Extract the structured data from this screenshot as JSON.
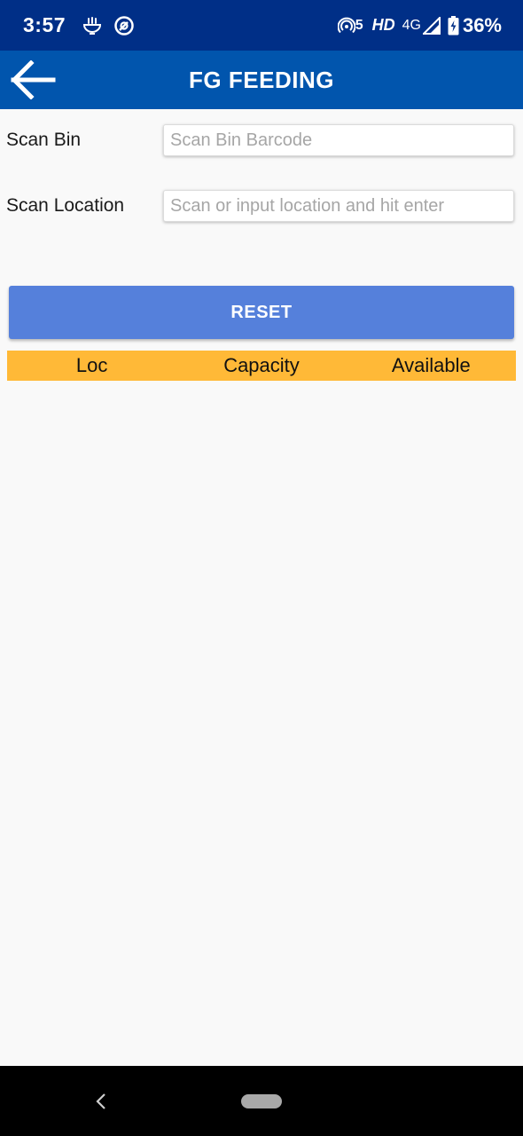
{
  "status_bar": {
    "time": "3:57",
    "hotspot_label": "5",
    "hd": "HD",
    "network": "4G",
    "battery": "36%",
    "icons": [
      "noodle-bowl-icon",
      "app-circle-icon",
      "hotspot-icon",
      "signal-icon",
      "battery-charging-icon"
    ]
  },
  "app_bar": {
    "title": "FG FEEDING",
    "back_icon": "arrow-left-icon"
  },
  "form": {
    "scan_bin": {
      "label": "Scan Bin",
      "placeholder": "Scan Bin Barcode",
      "value": ""
    },
    "scan_location": {
      "label": "Scan Location",
      "placeholder": "Scan or input location and hit enter",
      "value": ""
    }
  },
  "reset_button": {
    "label": "RESET"
  },
  "table": {
    "columns": [
      "Loc",
      "Capacity",
      "Available"
    ],
    "rows": []
  },
  "colors": {
    "status_bar": "#002f87",
    "app_bar": "#0155ad",
    "button": "#5580db",
    "table_header": "#ffb937",
    "background": "#f9f9f9"
  },
  "nav_bar": {
    "icons": [
      "nav-back-icon",
      "home-pill-icon"
    ]
  }
}
